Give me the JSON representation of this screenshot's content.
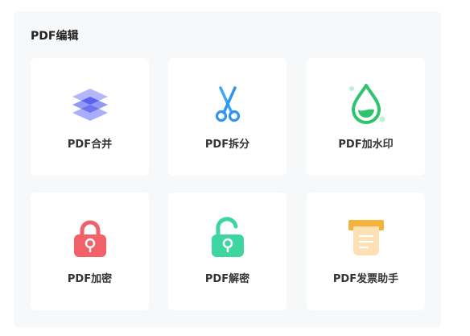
{
  "section": {
    "title": "PDF编辑"
  },
  "tools": [
    {
      "label": "PDF合并",
      "icon": "layers-icon",
      "color": "#7b83f2"
    },
    {
      "label": "PDF拆分",
      "icon": "scissors-icon",
      "color": "#2f95f0"
    },
    {
      "label": "PDF加水印",
      "icon": "water-drop-icon",
      "color": "#2ec46d"
    },
    {
      "label": "PDF加密",
      "icon": "lock-closed-icon",
      "color": "#f2606a"
    },
    {
      "label": "PDF解密",
      "icon": "lock-open-icon",
      "color": "#3dd6a0"
    },
    {
      "label": "PDF发票助手",
      "icon": "invoice-printer-icon",
      "color": "#f6b23a"
    }
  ]
}
